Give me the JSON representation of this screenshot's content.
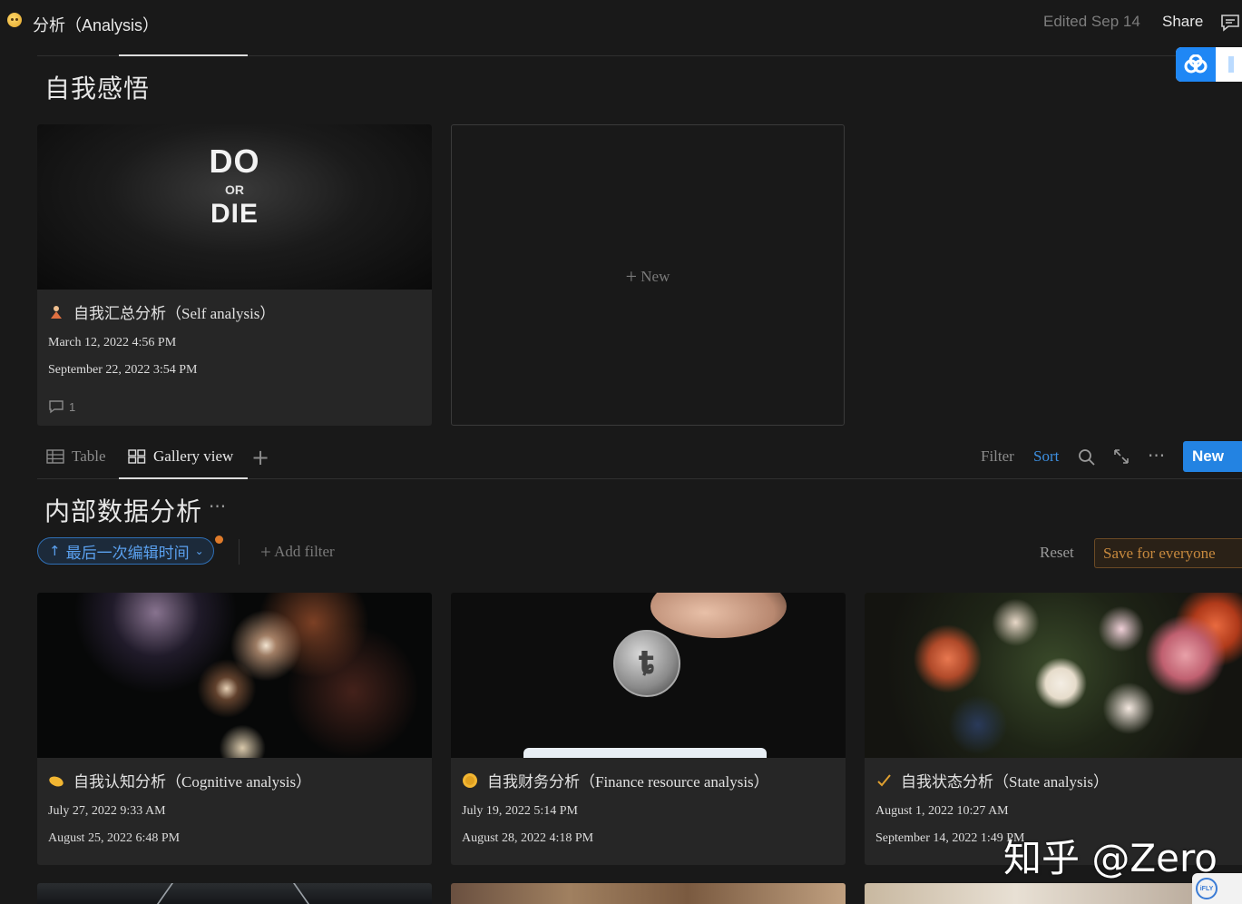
{
  "header": {
    "page_title": "分析（Analysis）",
    "edited": "Edited Sep 14",
    "share_label": "Share"
  },
  "section1": {
    "title": "自我感悟",
    "cards": [
      {
        "image_text_top": "DO",
        "image_text_mid": "OR",
        "image_text_bottom": "DIE",
        "title": "自我汇总分析（Self analysis）",
        "created": "March 12, 2022 4:56 PM",
        "edited": "September 22, 2022 3:54 PM",
        "comments": "1"
      }
    ],
    "new_card_label": "New"
  },
  "view_tabs": [
    {
      "label": "Table",
      "icon": "table-icon"
    },
    {
      "label": "Gallery view",
      "icon": "gallery-icon"
    }
  ],
  "toolbar": {
    "filter_label": "Filter",
    "sort_label": "Sort",
    "new_label": "New"
  },
  "section2": {
    "title": "内部数据分析",
    "sort_chip": "最后一次编辑时间",
    "add_filter": "Add filter",
    "reset": "Reset",
    "save": "Save for everyone",
    "cards": [
      {
        "title": "自我认知分析（Cognitive analysis）",
        "created": "July 27, 2022 9:33 AM",
        "edited": "August 25, 2022 6:48 PM",
        "icon": "pill-icon"
      },
      {
        "title": "自我财务分析（Finance resource analysis）",
        "created": "July 19, 2022 5:14 PM",
        "edited": "August 28, 2022 4:18 PM",
        "icon": "coin-icon"
      },
      {
        "title": "自我状态分析（State analysis）",
        "created": "August 1, 2022 10:27 AM",
        "edited": "September 14, 2022 1:49 PM",
        "icon": "check-icon"
      }
    ]
  },
  "watermark": "知乎 @Zero",
  "ifly_badge": "iFLY",
  "colors": {
    "accent": "#2383e2",
    "background": "#191919",
    "card": "#262626",
    "save": "#c88a3e"
  }
}
